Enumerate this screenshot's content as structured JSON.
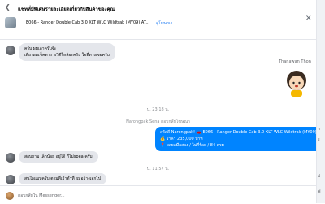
{
  "header": {
    "title": "แชทที่มีพิเศษรายละเอียดเกี่ยวกับสินค้าของคุณ",
    "product_name": "E066 - Ranger Double Cab 3.0 XLT WLC Wildtrak (MY09) AT...",
    "product_link": "ดูโฆษณา"
  },
  "messages": {
    "m1_line1": "ครับ ผมเอาครับจ๊ะ",
    "m1_line2": "เดี๋ยวผมเช็คตารางวิตีไหล้อะครับ ใจที่ทางเจอครับ",
    "sender_name": "Thanawan Thon",
    "time1": "น. 23:18 น.",
    "system_note": "Narongpak Sena ตอบกลับโฆษณา",
    "out_line1": "สวัสดี Narongpak! 🚗 E066 - Ranger Double Cab 3.0 XLT WLC Wildtrak (MY09) AT ...",
    "out_line2": "💰 ราคา 235,000 บาท",
    "out_line3": "📍 ยลยลมือสอง / ไม่กี่ร้อย / 84 ตรม",
    "m2": "สอบถาม เล็กน้อย อยู่ได้ กี่ไม่spea ครับ",
    "time2": "น. 11:57 น.",
    "m3": "สนใจแบบครับ ตามที่เจ้าต่ำที่ ผมอย่างเอกไป"
  },
  "composer": {
    "placeholder": "ตอบกลับใน Messenger..."
  },
  "rightcol": {
    "frag1": "ก",
    "frag2": "ร",
    "frag3": "ป",
    "frag4": "ฟ"
  }
}
